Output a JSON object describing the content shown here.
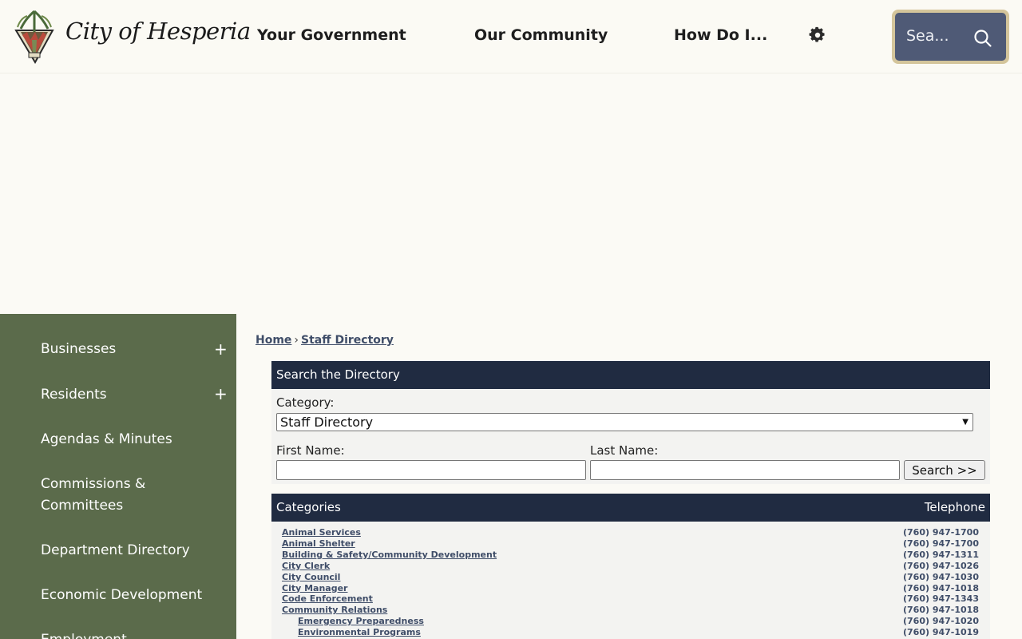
{
  "header": {
    "logo_text": "City of Hesperia",
    "nav": [
      "Your Government",
      "Our Community",
      "How Do I..."
    ],
    "search_placeholder": "Sea..."
  },
  "sidebar": {
    "items": [
      {
        "label": "Businesses",
        "expandable": true
      },
      {
        "label": "Residents",
        "expandable": true
      },
      {
        "label": "Agendas & Minutes",
        "expandable": false
      },
      {
        "label": "Commissions & Committees",
        "expandable": false
      },
      {
        "label": "Department Directory",
        "expandable": false
      },
      {
        "label": "Economic Development",
        "expandable": false
      },
      {
        "label": "Employment",
        "expandable": false
      }
    ],
    "plus_symbol": "+"
  },
  "breadcrumb": {
    "home": "Home",
    "sep": "›",
    "current": "Staff Directory"
  },
  "search_panel": {
    "title": "Search the Directory",
    "category_label": "Category:",
    "category_value": "Staff Directory",
    "first_name_label": "First Name:",
    "last_name_label": "Last Name:",
    "button_label": "Search >>"
  },
  "categories": {
    "header": "Categories",
    "phone_header": "Telephone",
    "rows": [
      {
        "name": "Animal Services",
        "phone": "(760) 947-1700",
        "indent": 0
      },
      {
        "name": "Animal Shelter",
        "phone": "(760) 947-1700",
        "indent": 0
      },
      {
        "name": "Building & Safety/Community Development",
        "phone": "(760) 947-1311",
        "indent": 0
      },
      {
        "name": "City Clerk",
        "phone": "(760) 947-1026",
        "indent": 0
      },
      {
        "name": "City Council",
        "phone": "(760) 947-1030",
        "indent": 0
      },
      {
        "name": "City Manager",
        "phone": "(760) 947-1018",
        "indent": 0
      },
      {
        "name": "Code Enforcement",
        "phone": "(760) 947-1343",
        "indent": 0
      },
      {
        "name": "Community Relations",
        "phone": "(760) 947-1018",
        "indent": 0
      },
      {
        "name": "Emergency Preparedness",
        "phone": "(760) 947-1020",
        "indent": 1
      },
      {
        "name": "Environmental Programs",
        "phone": "(760) 947-1019",
        "indent": 1
      }
    ]
  },
  "colors": {
    "header_bg": "#fbfaf4",
    "sidebar_bg": "#5b6b4b",
    "panel_head_bg": "#202b41",
    "search_bg": "#4f5a76",
    "search_border": "#d4c59b",
    "link": "#3f4d68"
  },
  "icons": {
    "settings": "gear-icon",
    "search": "search-icon",
    "logo": "city-logo-icon"
  }
}
